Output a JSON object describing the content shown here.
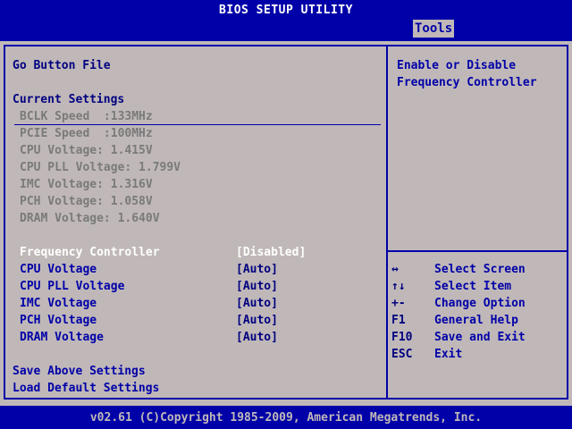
{
  "header": {
    "title": "BIOS SETUP UTILITY",
    "active_tab": "Tools"
  },
  "main": {
    "section_title": "Go Button File",
    "current_settings_header": "Current Settings",
    "readouts": [
      "BCLK Speed  :133MHz",
      "PCIE Speed  :100MHz",
      "CPU Voltage: 1.415V",
      "CPU PLL Voltage: 1.799V",
      "IMC Voltage: 1.316V",
      "PCH Voltage: 1.058V",
      "DRAM Voltage: 1.640V"
    ],
    "settings": [
      {
        "label": "Frequency Controller",
        "value": "[Disabled]",
        "selected": true
      },
      {
        "label": "CPU Voltage",
        "value": "[Auto]",
        "selected": false
      },
      {
        "label": "CPU PLL Voltage",
        "value": "[Auto]",
        "selected": false
      },
      {
        "label": "IMC Voltage",
        "value": "[Auto]",
        "selected": false
      },
      {
        "label": "PCH Voltage",
        "value": "[Auto]",
        "selected": false
      },
      {
        "label": "DRAM Voltage",
        "value": "[Auto]",
        "selected": false
      }
    ],
    "actions": [
      "Save Above Settings",
      "Load Default Settings"
    ]
  },
  "help": {
    "description_line1": "Enable or Disable",
    "description_line2": "Frequency Controller",
    "keys": [
      {
        "key": "↔",
        "desc": "Select Screen"
      },
      {
        "key": "↑↓",
        "desc": "Select Item"
      },
      {
        "key": "+-",
        "desc": "Change Option"
      },
      {
        "key": "F1",
        "desc": "General Help"
      },
      {
        "key": "F10",
        "desc": "Save and Exit"
      },
      {
        "key": "ESC",
        "desc": "Exit"
      }
    ]
  },
  "footer": {
    "copyright": "v02.61 (C)Copyright 1985-2009, American Megatrends, Inc."
  },
  "colors": {
    "frame_blue": "#0000a8",
    "panel_gray": "#c0b8b8",
    "readout_gray": "#7a7a7a",
    "selected_white": "#ffffff"
  }
}
